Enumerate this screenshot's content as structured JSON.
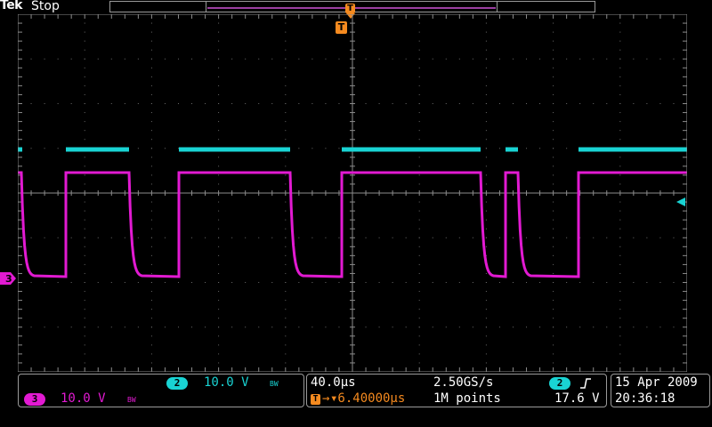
{
  "header": {
    "brand": "Tek",
    "acq_status": "Stop",
    "trigger_label": "T"
  },
  "colors": {
    "ch2": "#19d3d3",
    "ch3": "#e21ad2",
    "trigger": "#f58a1f",
    "grid": "#8c8c8c"
  },
  "channels": {
    "ch2": {
      "number": "2",
      "scale": "10.0 V",
      "bw": "BW"
    },
    "ch3": {
      "number": "3",
      "scale": "10.0 V",
      "bw": "BW"
    }
  },
  "horizontal": {
    "time_div": "40.0µs",
    "sample_rate": "2.50GS/s",
    "trigger_prefix": "T",
    "trigger_delay": "▾6.40000µs",
    "record_length": "1M points"
  },
  "trigger": {
    "source": "2",
    "slope": "rising-edge-icon",
    "level": "17.6 V"
  },
  "datetime": {
    "date": "15 Apr 2009",
    "time": "20:36:18"
  }
}
